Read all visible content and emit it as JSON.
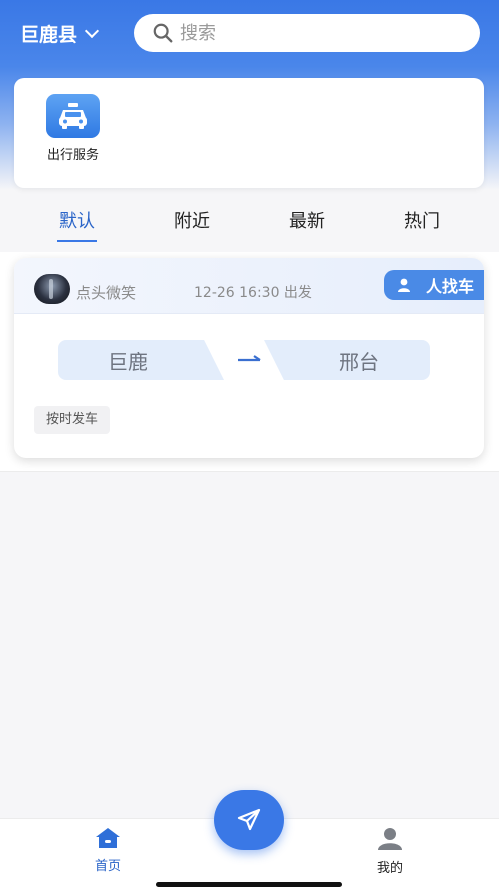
{
  "header": {
    "city": "巨鹿县",
    "search_placeholder": "搜索"
  },
  "services": [
    {
      "label": "出行服务",
      "icon": "taxi-icon"
    }
  ],
  "tabs": [
    {
      "label": "默认",
      "active": true
    },
    {
      "label": "附近",
      "active": false
    },
    {
      "label": "最新",
      "active": false
    },
    {
      "label": "热门",
      "active": false
    }
  ],
  "trips": [
    {
      "driver": "点头微笑",
      "depart_time": "12-26 16:30 出发",
      "role": "人找车",
      "from": "巨鹿",
      "to": "邢台",
      "tag": "按时发车"
    }
  ],
  "bottom_nav": {
    "home": "首页",
    "mine": "我的"
  },
  "colors": {
    "accent": "#3a78e6",
    "active_text": "#2a64c8"
  }
}
